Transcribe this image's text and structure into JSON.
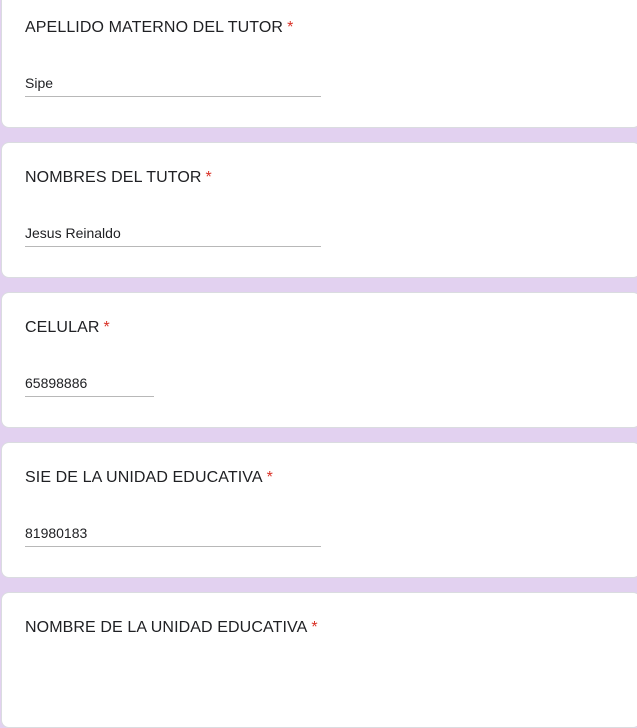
{
  "questions": [
    {
      "title": "APELLIDO MATERNO DEL TUTOR",
      "required_mark": "*",
      "value": "Sipe"
    },
    {
      "title": "NOMBRES DEL TUTOR",
      "required_mark": "*",
      "value": "Jesus Reinaldo"
    },
    {
      "title": "CELULAR",
      "required_mark": "*",
      "value": "65898886"
    },
    {
      "title": "SIE DE LA UNIDAD EDUCATIVA",
      "required_mark": "*",
      "value": "81980183"
    },
    {
      "title": "NOMBRE DE LA UNIDAD EDUCATIVA",
      "required_mark": "*",
      "value": ""
    }
  ],
  "colors": {
    "background": "#e2d1f0",
    "card": "#ffffff",
    "required": "#d93025",
    "text": "#202124"
  }
}
